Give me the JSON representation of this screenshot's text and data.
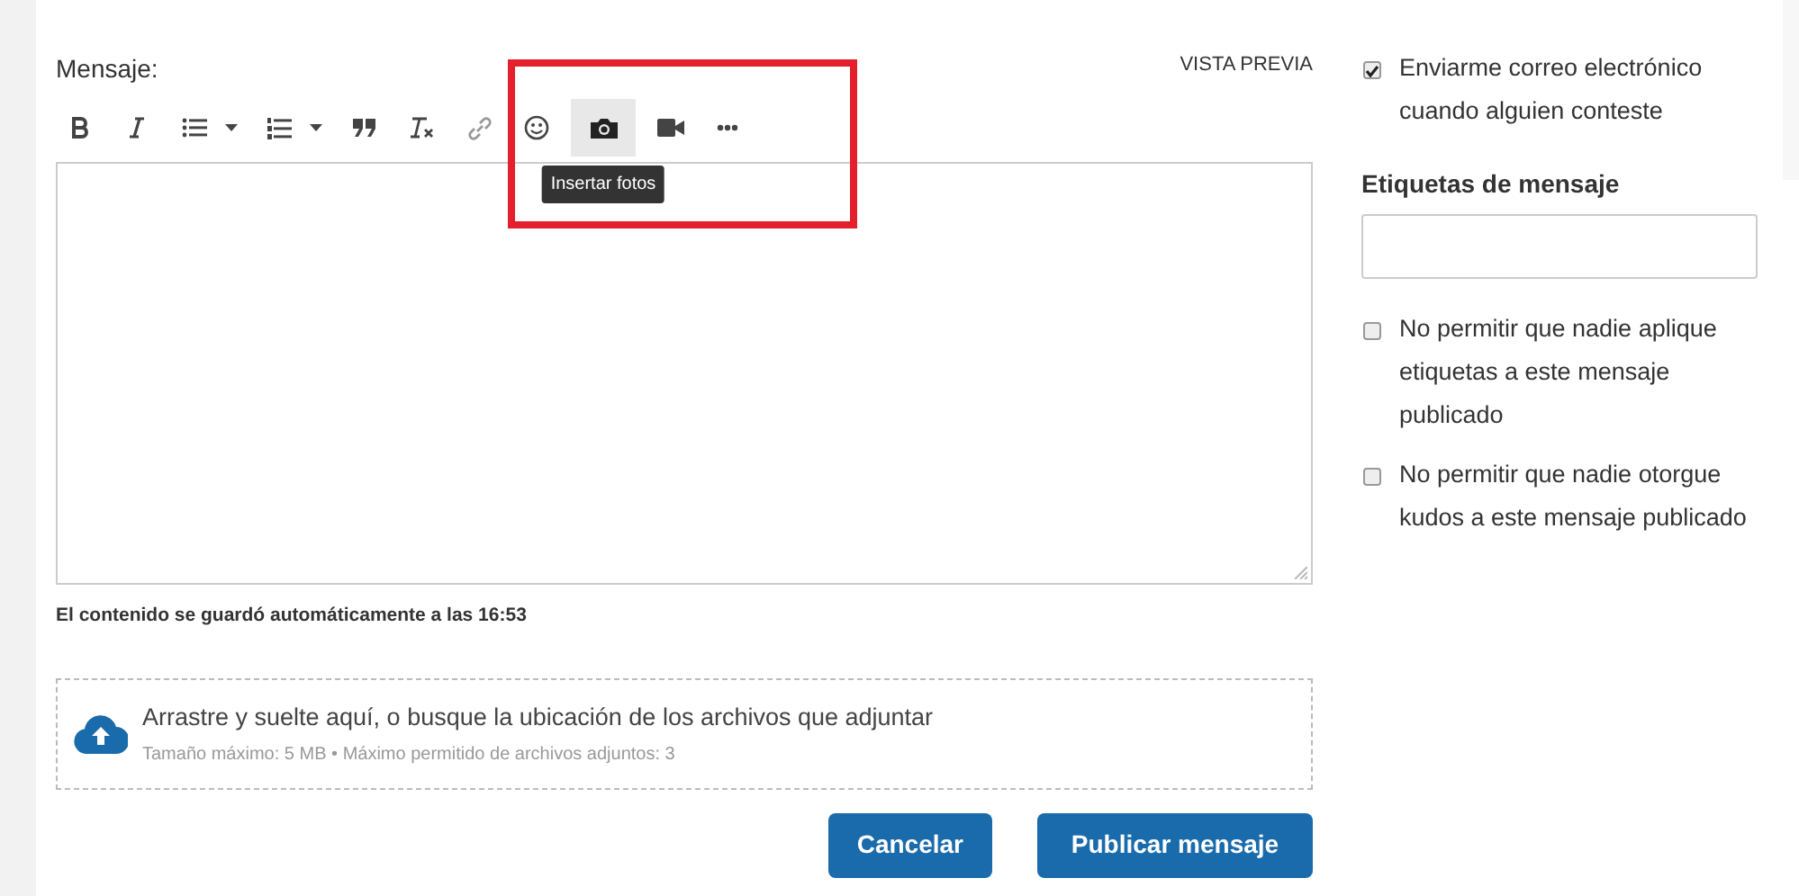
{
  "editor": {
    "label": "Mensaje:",
    "preview_link": "VISTA PREVIA",
    "toolbar": [
      {
        "kind": "bold",
        "hovered": false
      },
      {
        "kind": "italic",
        "hovered": false
      },
      {
        "kind": "bullets",
        "hovered": false
      },
      {
        "kind": "caret",
        "hovered": false
      },
      {
        "kind": "numbers",
        "hovered": false
      },
      {
        "kind": "caret",
        "hovered": false
      },
      {
        "kind": "quote",
        "hovered": false
      },
      {
        "kind": "clear",
        "hovered": false
      },
      {
        "kind": "link",
        "hovered": false
      },
      {
        "kind": "emoji",
        "hovered": false
      },
      {
        "kind": "camera",
        "hovered": true,
        "tooltip": "Insertar fotos"
      },
      {
        "kind": "video",
        "hovered": false
      },
      {
        "kind": "more",
        "hovered": false
      }
    ],
    "autosave": "El contenido se guardó automáticamente a las 16:53"
  },
  "attachments": {
    "before": "Arrastre y suelte aquí, o ",
    "link": "busque",
    "after": " la ubicación de los archivos que adjuntar",
    "limits": "Tamaño máximo: 5 MB • Máximo permitido de archivos adjuntos: 3"
  },
  "buttons": [
    "Cancelar",
    "Publicar mensaje"
  ],
  "options": {
    "email": {
      "label": "Enviarme correo electrónico cuando alguien conteste",
      "checked": true
    },
    "tags_label": "Etiquetas de mensaje",
    "checks": [
      {
        "label": "No permitir que nadie aplique etiquetas a este mensaje publicado",
        "checked": false
      },
      {
        "label": "No permitir que nadie otorgue kudos a este mensaje publicado",
        "checked": false
      }
    ]
  }
}
